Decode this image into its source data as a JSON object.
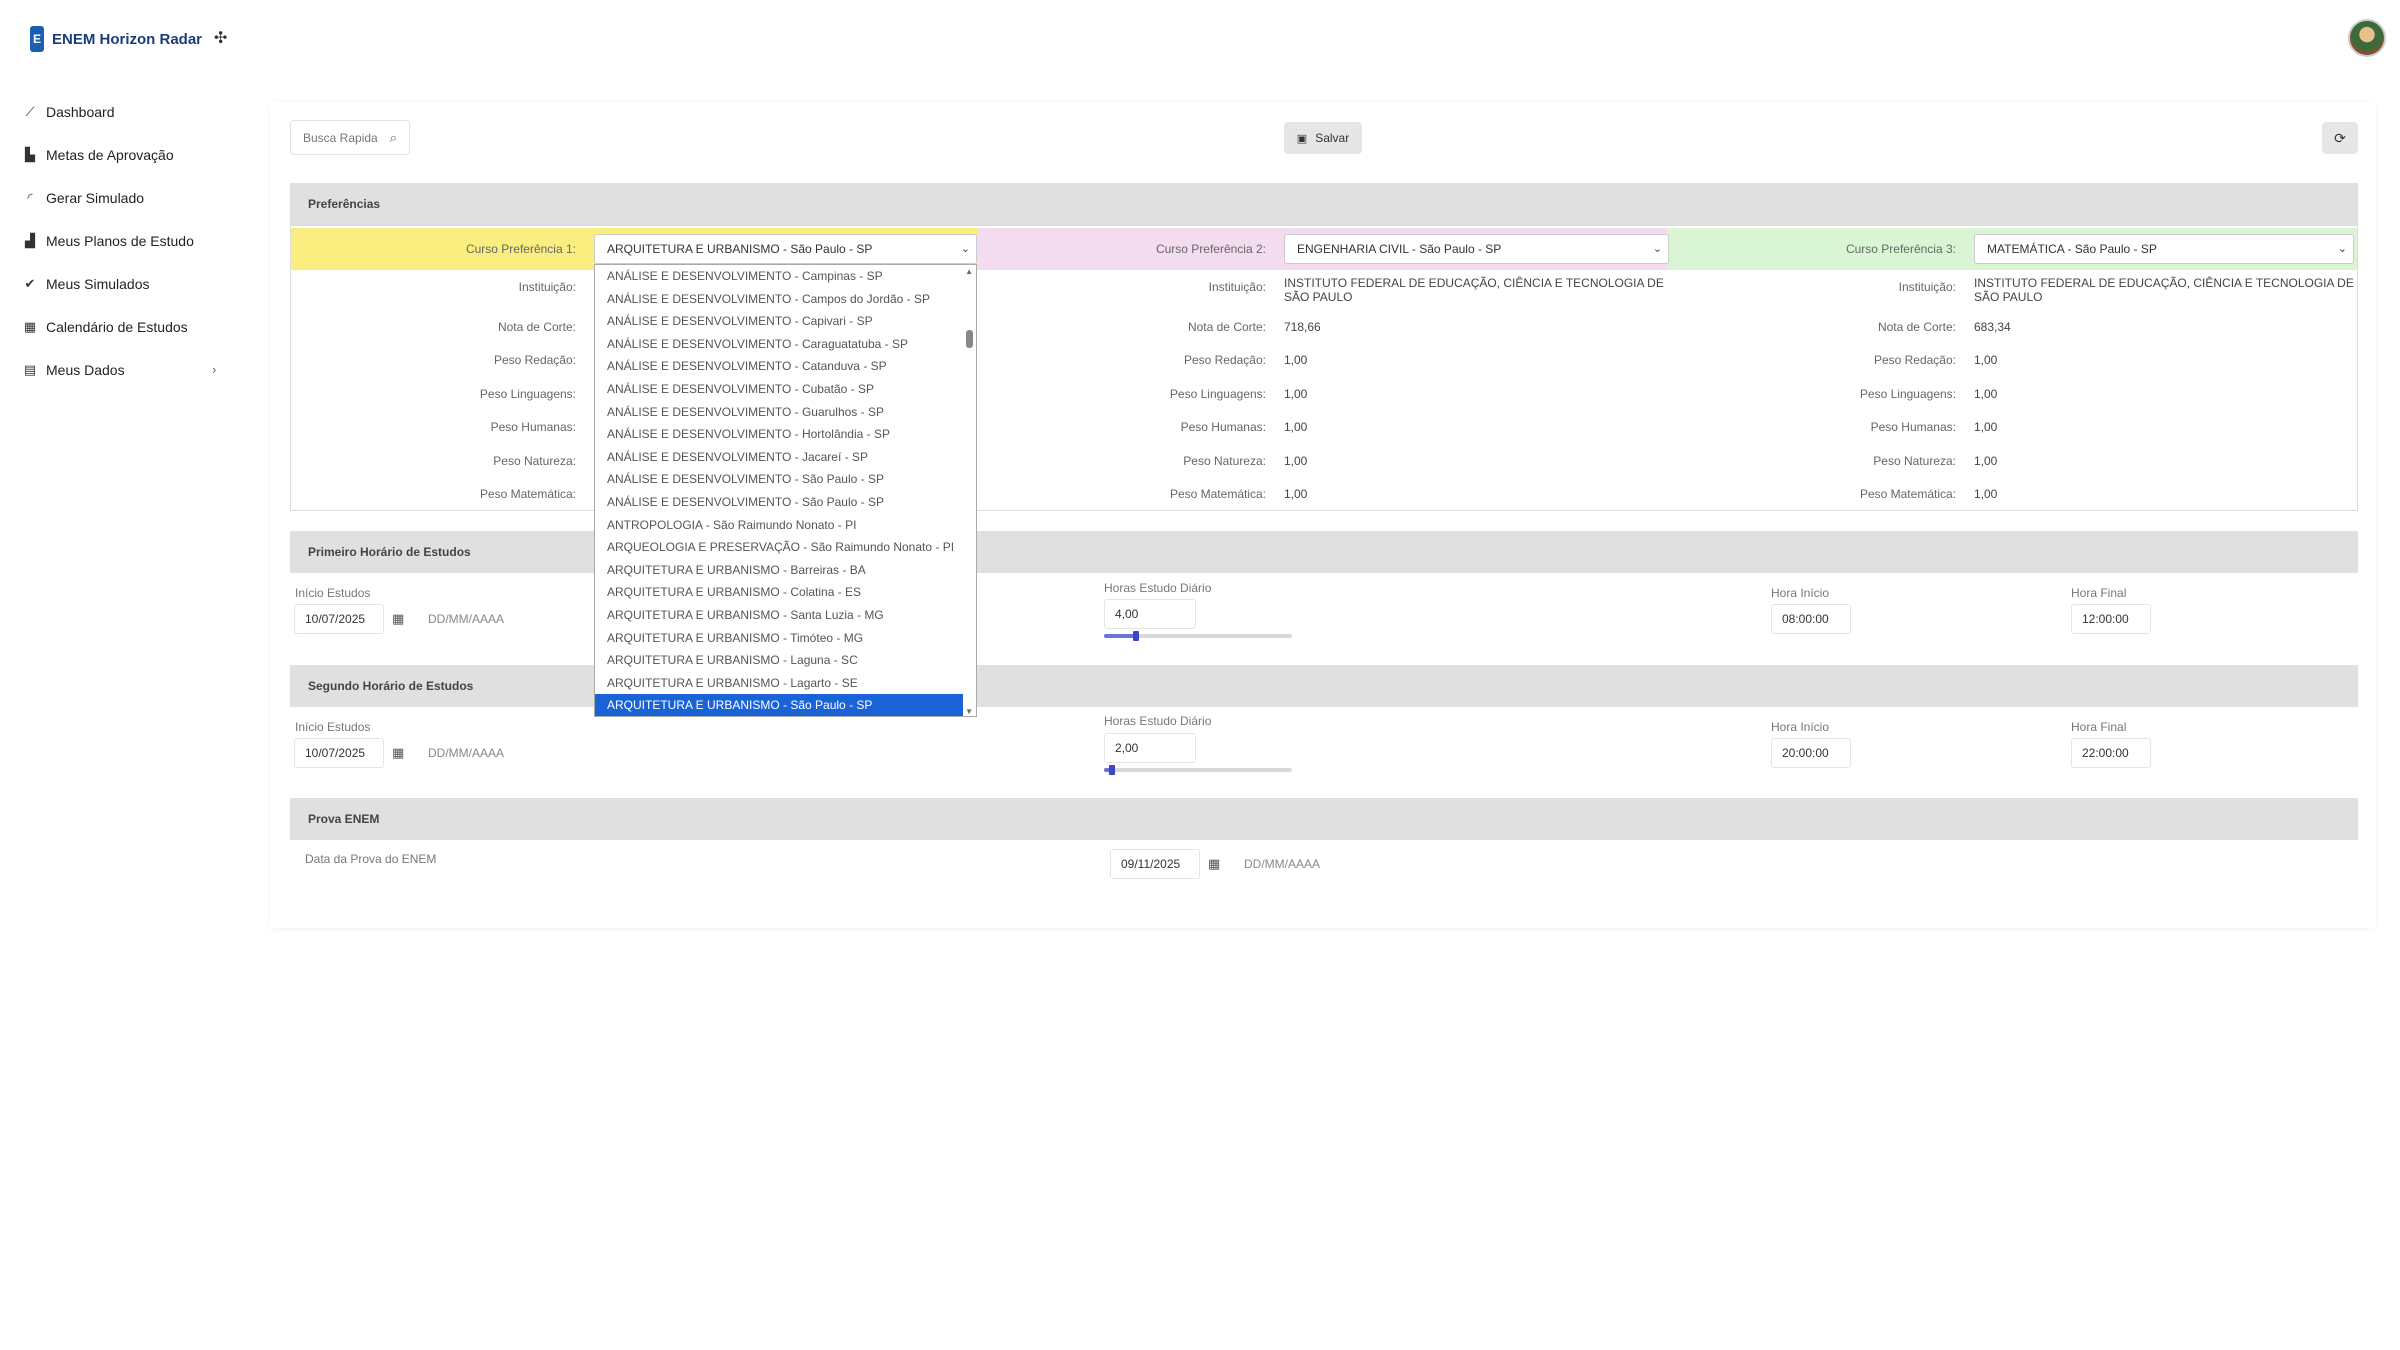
{
  "app": {
    "title": "ENEM Horizon Radar",
    "logo_letter": "E"
  },
  "sidebar": {
    "items": [
      {
        "label": "Dashboard",
        "icon": "chart-line-icon"
      },
      {
        "label": "Metas de Aprovação",
        "icon": "bar-chart-icon"
      },
      {
        "label": "Gerar Simulado",
        "icon": "rss-icon"
      },
      {
        "label": "Meus Planos de Estudo",
        "icon": "chart-multi-icon"
      },
      {
        "label": "Meus Simulados",
        "icon": "check-double-icon"
      },
      {
        "label": "Calendário de Estudos",
        "icon": "calendar-icon"
      },
      {
        "label": "Meus Dados",
        "icon": "id-card-icon"
      }
    ]
  },
  "toolbar": {
    "search_placeholder": "Busca Rapida",
    "save_label": "Salvar"
  },
  "preferences": {
    "section_title": "Preferências",
    "labels": {
      "instituicao": "Instituição:",
      "nota_corte": "Nota de Corte:",
      "peso_redacao": "Peso Redação:",
      "peso_linguagens": "Peso Linguagens:",
      "peso_humanas": "Peso Humanas:",
      "peso_natureza": "Peso Natureza:",
      "peso_matematica": "Peso Matemática:"
    },
    "col1": {
      "label": "Curso Preferência 1:",
      "selected": "ARQUITETURA E URBANISMO - São Paulo - SP",
      "color": "#fbee80"
    },
    "col2": {
      "label": "Curso Preferência 2:",
      "selected": "ENGENHARIA CIVIL - São Paulo - SP",
      "color": "#f4dcf0",
      "instituicao": "INSTITUTO FEDERAL DE EDUCAÇÃO, CIÊNCIA E TECNOLOGIA DE SÃO PAULO",
      "nota_corte": "718,66",
      "peso_redacao": "1,00",
      "peso_linguagens": "1,00",
      "peso_humanas": "1,00",
      "peso_natureza": "1,00",
      "peso_matematica": "1,00"
    },
    "col3": {
      "label": "Curso Preferência 3:",
      "selected": "MATEMÁTICA - São Paulo - SP",
      "color": "#d9f5d3",
      "instituicao": "INSTITUTO FEDERAL DE EDUCAÇÃO, CIÊNCIA E TECNOLOGIA DE SÃO PAULO",
      "nota_corte": "683,34",
      "peso_redacao": "1,00",
      "peso_linguagens": "1,00",
      "peso_humanas": "1,00",
      "peso_natureza": "1,00",
      "peso_matematica": "1,00"
    },
    "dropdown_options": [
      "ANÁLISE E DESENVOLVIMENTO - Campinas - SP",
      "ANÁLISE E DESENVOLVIMENTO - Campos do Jordão - SP",
      "ANÁLISE E DESENVOLVIMENTO - Capivari - SP",
      "ANÁLISE E DESENVOLVIMENTO - Caraguatatuba - SP",
      "ANÁLISE E DESENVOLVIMENTO - Catanduva - SP",
      "ANÁLISE E DESENVOLVIMENTO - Cubatão - SP",
      "ANÁLISE E DESENVOLVIMENTO - Guarulhos - SP",
      "ANÁLISE E DESENVOLVIMENTO - Hortolândia - SP",
      "ANÁLISE E DESENVOLVIMENTO - Jacareí - SP",
      "ANÁLISE E DESENVOLVIMENTO - São Paulo - SP",
      "ANÁLISE E DESENVOLVIMENTO - São Paulo - SP",
      "ANTROPOLOGIA - São Raimundo Nonato - PI",
      "ARQUEOLOGIA E PRESERVAÇÃO - São Raimundo Nonato - PI",
      "ARQUITETURA E URBANISMO - Barreiras - BA",
      "ARQUITETURA E URBANISMO - Colatina - ES",
      "ARQUITETURA E URBANISMO - Santa Luzia - MG",
      "ARQUITETURA E URBANISMO - Timóteo - MG",
      "ARQUITETURA E URBANISMO - Laguna - SC",
      "ARQUITETURA E URBANISMO - Lagarto - SE",
      "ARQUITETURA E URBANISMO - São Paulo - SP"
    ]
  },
  "schedule1": {
    "title": "Primeiro Horário de Estudos",
    "inicio_label": "Início Estudos",
    "inicio_value": "10/07/2025",
    "inicio_placeholder": "DD/MM/AAAA",
    "horas_label": "Horas Estudo Diário",
    "horas_value": "4,00",
    "horas_slider": 0.17,
    "hora_inicio_label": "Hora Início",
    "hora_inicio_value": "08:00:00",
    "hora_final_label": "Hora Final",
    "hora_final_value": "12:00:00"
  },
  "schedule2": {
    "title": "Segundo Horário de Estudos",
    "inicio_label": "Início Estudos",
    "inicio_value": "10/07/2025",
    "inicio_placeholder": "DD/MM/AAAA",
    "horas_label": "Horas Estudo Diário",
    "horas_value": "2,00",
    "horas_slider": 0.04,
    "hora_inicio_label": "Hora Início",
    "hora_inicio_value": "20:00:00",
    "hora_final_label": "Hora Final",
    "hora_final_value": "22:00:00"
  },
  "prova": {
    "title": "Prova ENEM",
    "data_label": "Data da Prova do ENEM",
    "data_value": "09/11/2025",
    "data_placeholder": "DD/MM/AAAA"
  }
}
